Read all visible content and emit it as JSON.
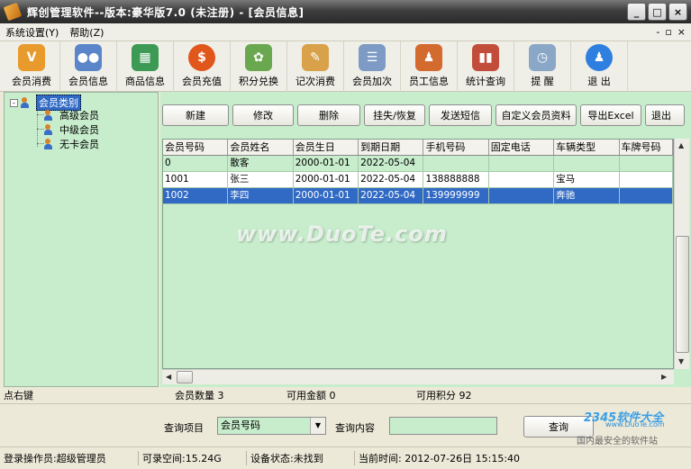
{
  "window": {
    "title": "辉创管理软件--版本:豪华版7.0 (未注册) - [会员信息]",
    "controls": [
      "_",
      "□",
      "×"
    ]
  },
  "menu": {
    "items": [
      "系统设置(Y)",
      "帮助(Z)"
    ],
    "mdi_controls": [
      "-",
      "▫",
      "×"
    ]
  },
  "toolbar": {
    "items": [
      {
        "label": "会员消费",
        "icon": "vip-card-icon",
        "color": "#e89a2c"
      },
      {
        "label": "会员信息",
        "icon": "members-icon",
        "color": "#5a86c9"
      },
      {
        "label": "商品信息",
        "icon": "goods-grid-icon",
        "color": "#3c9a54"
      },
      {
        "label": "会员充值",
        "icon": "dollar-coin-icon",
        "color": "#e0561b"
      },
      {
        "label": "积分兑换",
        "icon": "gift-points-icon",
        "color": "#6aa84f"
      },
      {
        "label": "记次消费",
        "icon": "pen-record-icon",
        "color": "#d8a14a"
      },
      {
        "label": "会员加次",
        "icon": "notepad-icon",
        "color": "#7d9bc4"
      },
      {
        "label": "员工信息",
        "icon": "employee-icon",
        "color": "#d36a2e"
      },
      {
        "label": "统计查询",
        "icon": "stats-bars-icon",
        "color": "#c24d3a"
      },
      {
        "label": "提 醒",
        "icon": "reminder-clock-icon",
        "color": "#8aa7c8"
      },
      {
        "label": "退 出",
        "icon": "exit-person-icon",
        "color": "#2f7fe0"
      }
    ]
  },
  "tree": {
    "root": "会员类别",
    "toggle": "-",
    "children": [
      "高级会员",
      "中级会员",
      "无卡会员"
    ]
  },
  "actions": {
    "buttons": [
      "新建",
      "修改",
      "删除",
      "挂失/恢复",
      "发送短信",
      "自定义会员资料",
      "导出Excel",
      "退出"
    ]
  },
  "grid": {
    "columns": [
      "会员号码",
      "会员姓名",
      "会员生日",
      "到期日期",
      "手机号码",
      "固定电话",
      "车辆类型",
      "车牌号码"
    ],
    "rows": [
      [
        "0",
        "散客",
        "2000-01-01",
        "2022-05-04",
        "",
        "",
        "",
        ""
      ],
      [
        "1001",
        "张三",
        "2000-01-01",
        "2022-05-04",
        "138888888",
        "",
        "宝马",
        ""
      ],
      [
        "1002",
        "李四",
        "2000-01-01",
        "2022-05-04",
        "139999999",
        "",
        "奔驰",
        ""
      ]
    ],
    "selected_row": 2
  },
  "status": {
    "left": "点右键",
    "member_count": "会员数量 3",
    "available_amount": "可用金额 0",
    "available_points": "可用积分 92"
  },
  "query": {
    "item_label": "查询项目",
    "item_value": "会员号码",
    "content_label": "查询内容",
    "content_value": "",
    "button": "查询"
  },
  "bottom": {
    "operator": "登录操作员:超级管理员",
    "disk_space": "可录空间:15.24G",
    "device_status": "设备状态:未找到",
    "current_time": "当前时间: 2012-07-26日 15:15:40"
  },
  "watermarks": {
    "center": "www.DuoTe.com",
    "logo": "2345软件大全",
    "site": "www.DuoTe.com",
    "tag": "国内最安全的软件站"
  }
}
